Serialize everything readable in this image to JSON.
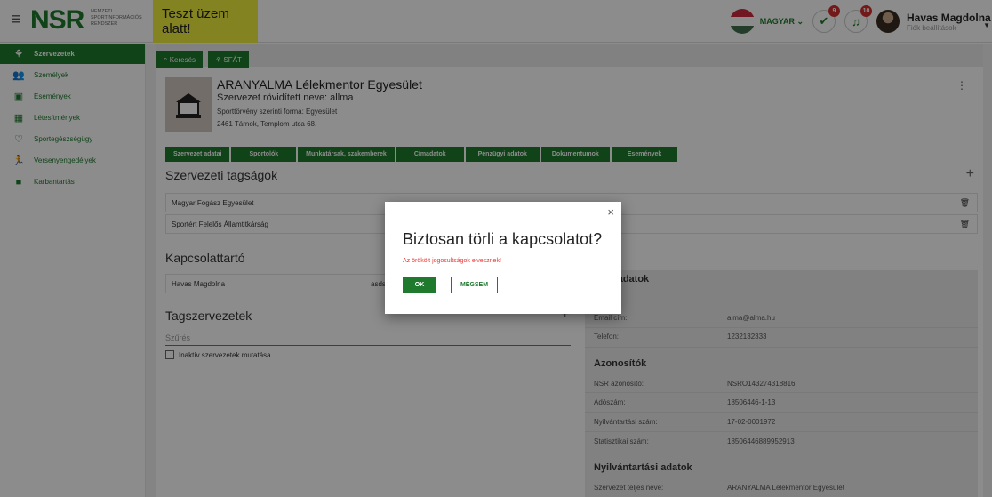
{
  "header": {
    "logo": "NSR",
    "logo_sub": "NEMZETI SPORTINFORMÁCIÓS RENDSZER",
    "test_banner": "Teszt üzem alatt!",
    "language": "MAGYAR",
    "tasks_badge": "9",
    "notif_badge": "10",
    "user_name": "Havas Magdolna",
    "user_sub": "Fiók beállítások"
  },
  "sidebar": {
    "items": [
      {
        "label": "Szervezetek",
        "icon": "org-icon"
      },
      {
        "label": "Személyek",
        "icon": "people-icon"
      },
      {
        "label": "Események",
        "icon": "calendar-icon"
      },
      {
        "label": "Létesítmények",
        "icon": "building-icon"
      },
      {
        "label": "Sportegészségügy",
        "icon": "heart-icon"
      },
      {
        "label": "Versenyengedélyek",
        "icon": "runner-icon"
      },
      {
        "label": "Karbantartás",
        "icon": "book-icon"
      }
    ]
  },
  "topnav": {
    "search": "Keresés",
    "sfat": "SFÁT"
  },
  "org": {
    "name": "ARANYALMA Lélekmentor Egyesület",
    "short_name": "Szervezet rövidített neve: allma",
    "form": "Sporttörvény szerinti forma: Egyesület",
    "address": "2461 Tárnok, Templom utca 68."
  },
  "tabs": [
    "Szervezet adatai",
    "Sportolók",
    "Munkatársak, szakemberek",
    "Címadatok",
    "Pénzügyi adatok",
    "Dokumentumok",
    "Események"
  ],
  "memberships": {
    "title": "Szervezeti tagságok",
    "rows": [
      "Magyar Fogász Egyesület",
      "Sportért Felelős Államtitkárság"
    ]
  },
  "contact": {
    "title": "Kapcsolattartó",
    "name": "Havas Magdolna",
    "extra": "asds"
  },
  "members": {
    "title": "Tagszervezetek",
    "filter_placeholder": "Szűrés",
    "inactive_label": "Inaktív szervezetek mutatása"
  },
  "panel": {
    "contact_title": "t adatok",
    "email_label": "Email cím:",
    "email": "alma@alma.hu",
    "phone_label": "Telefon:",
    "phone": "1232132333",
    "ids_title": "Azonosítók",
    "nsr_label": "NSR azonosító:",
    "nsr": "NSRO143274318816",
    "tax_label": "Adószám:",
    "tax": "18506446-1-13",
    "reg_label": "Nyilvántartási szám:",
    "reg": "17-02-0001972",
    "stat_label": "Statisztikai szám:",
    "stat": "18506446889952913",
    "records_title": "Nyilvántartási adatok",
    "fullname_label": "Szervezet teljes neve:",
    "fullname": "ARANYALMA Lélekmentor Egyesület"
  },
  "dialog": {
    "title": "Biztosan törli a kapcsolatot?",
    "warning": "Az örökölt jogosultságok elvesznek!",
    "ok": "OK",
    "cancel": "MÉGSEM"
  },
  "colors": {
    "brand": "#1f7a2e",
    "banner": "#f1ee3f",
    "warning": "#e53935"
  }
}
